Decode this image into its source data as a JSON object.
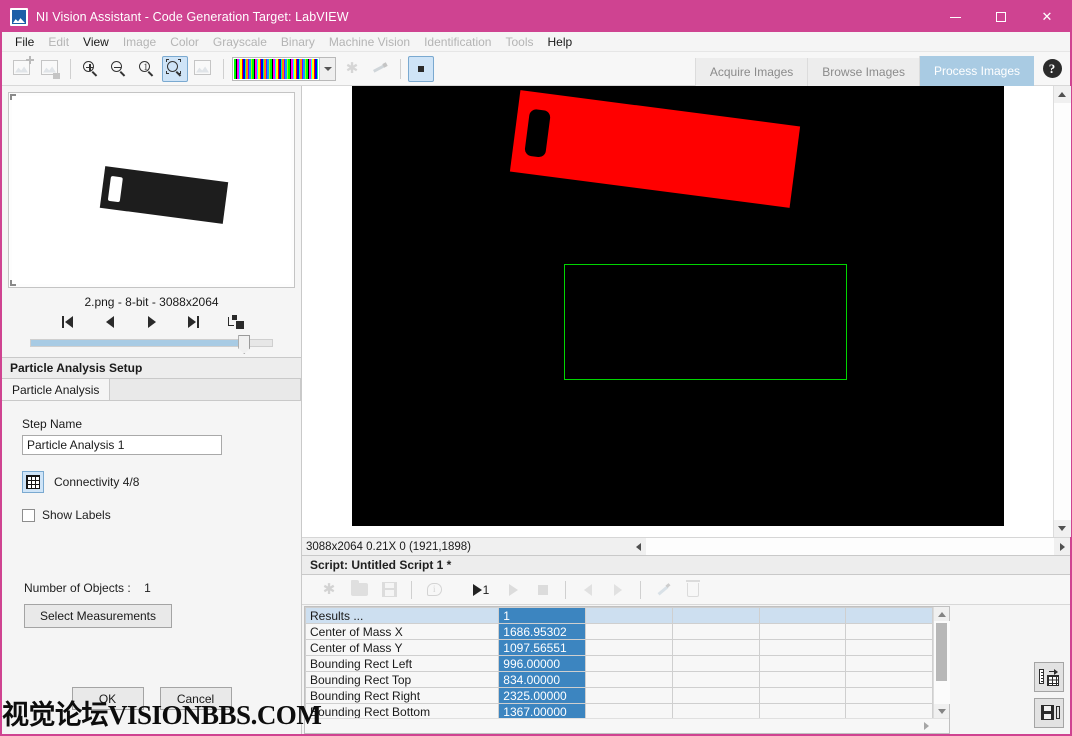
{
  "window": {
    "title": "NI Vision Assistant - Code Generation Target: LabVIEW",
    "app_icon": "image-app-icon",
    "minimize": "minimize-icon",
    "maximize": "maximize-icon",
    "close": "close-icon",
    "titlebar_color": "#cf4391"
  },
  "menu": {
    "items": [
      {
        "label": "File",
        "enabled": true
      },
      {
        "label": "Edit",
        "enabled": false
      },
      {
        "label": "View",
        "enabled": true
      },
      {
        "label": "Image",
        "enabled": false
      },
      {
        "label": "Color",
        "enabled": false
      },
      {
        "label": "Grayscale",
        "enabled": false
      },
      {
        "label": "Binary",
        "enabled": false
      },
      {
        "label": "Machine Vision",
        "enabled": false
      },
      {
        "label": "Identification",
        "enabled": false
      },
      {
        "label": "Tools",
        "enabled": false
      },
      {
        "label": "Help",
        "enabled": true
      }
    ]
  },
  "toolbar": {
    "buttons": [
      {
        "name": "open-image-icon",
        "enabled": false
      },
      {
        "name": "save-image-icon",
        "enabled": false
      },
      {
        "name": "zoom-in-icon",
        "enabled": true
      },
      {
        "name": "zoom-out-icon",
        "enabled": true
      },
      {
        "name": "zoom-actual-size-icon",
        "enabled": true
      },
      {
        "name": "zoom-to-fit-icon",
        "enabled": true,
        "selected": true
      },
      {
        "name": "image-properties-icon",
        "enabled": false
      },
      {
        "name": "color-palette-dropdown",
        "enabled": true
      },
      {
        "name": "highlight-icon",
        "enabled": false
      },
      {
        "name": "annotate-icon",
        "enabled": false
      },
      {
        "name": "roi-square-tool-icon",
        "enabled": true,
        "selected": true
      }
    ],
    "tabs": [
      {
        "label": "Acquire Images",
        "active": false
      },
      {
        "label": "Browse Images",
        "active": false
      },
      {
        "label": "Process Images",
        "active": true
      }
    ],
    "help_icon": "help-question-icon"
  },
  "browser": {
    "caption": "2.png - 8-bit - 3088x2064",
    "nav": {
      "first": "first-image-icon",
      "previous": "previous-image-icon",
      "next": "next-image-icon",
      "last": "last-image-icon",
      "layout": "thumbnail-layout-icon"
    },
    "slider_value": "86"
  },
  "setup": {
    "header": "Particle Analysis Setup",
    "tab": "Particle Analysis",
    "step_name_label": "Step Name",
    "step_name_value": "Particle Analysis 1",
    "step_name_placeholder": "Step Name",
    "connectivity_label": "Connectivity 4/8",
    "connectivity_icon": "connectivity-grid-icon",
    "show_labels_label": "Show Labels",
    "show_labels_checked": false,
    "objects_label": "Number of Objects :",
    "objects_value": "1",
    "select_measurements": "Select Measurements",
    "ok": "OK",
    "cancel": "Cancel"
  },
  "image_view": {
    "status": "3088x2064 0.21X 0   (1921,1898)",
    "resolution": "3088x2064",
    "zoom": "0.21X",
    "pixel_value": "0",
    "coordinates": "(1921,1898)",
    "overlay_color": "#00d500",
    "particle_color": "#ff0000",
    "background_color": "#000000",
    "vscroll_up": "scroll-up-icon",
    "vscroll_down": "scroll-down-icon",
    "hscroll_left": "scroll-left-icon",
    "hscroll_right": "scroll-right-icon"
  },
  "script": {
    "header": "Script: Untitled Script 1 *",
    "buttons": [
      {
        "name": "new-script-icon",
        "enabled": false
      },
      {
        "name": "open-script-icon",
        "enabled": false
      },
      {
        "name": "save-script-icon",
        "enabled": false
      },
      {
        "name": "script-comment-icon",
        "enabled": false
      },
      {
        "name": "run-once-icon",
        "enabled": true
      },
      {
        "name": "run-script-icon",
        "enabled": false
      },
      {
        "name": "stop-script-icon",
        "enabled": false
      },
      {
        "name": "step-back-icon",
        "enabled": false
      },
      {
        "name": "step-forward-icon",
        "enabled": false
      },
      {
        "name": "edit-step-icon",
        "enabled": false
      },
      {
        "name": "delete-step-icon",
        "enabled": false
      }
    ],
    "run_once_label": "1"
  },
  "results": {
    "header_first": "Results ...",
    "columns": [
      "1",
      "",
      "",
      "",
      ""
    ],
    "rows": [
      {
        "label": "Center of Mass X",
        "value": "1686.95302"
      },
      {
        "label": "Center of Mass Y",
        "value": "1097.56551"
      },
      {
        "label": "Bounding Rect Left",
        "value": "996.00000"
      },
      {
        "label": "Bounding Rect Top",
        "value": "834.00000"
      },
      {
        "label": "Bounding Rect Right",
        "value": "2325.00000"
      },
      {
        "label": "Bounding Rect Bottom",
        "value": "1367.00000"
      }
    ],
    "export_button": "export-results-to-table-icon",
    "save_button": "save-results-icon",
    "scroll_up": "results-scroll-up-icon",
    "scroll_down": "results-scroll-down-icon",
    "scroll_right": "results-scroll-right-icon"
  },
  "watermark": "视觉论坛VISIONBBS.COM"
}
